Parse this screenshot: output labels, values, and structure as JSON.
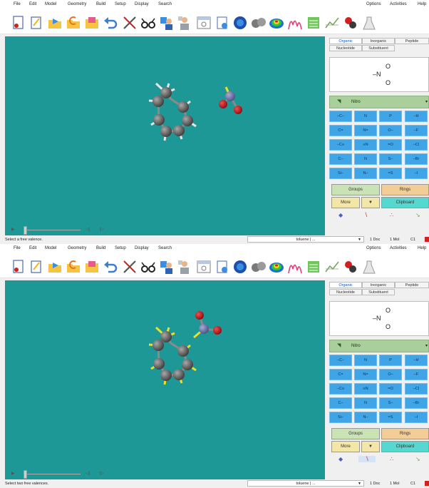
{
  "menu": [
    "File",
    "Edit",
    "Model",
    "Geometry",
    "Build",
    "Setup",
    "Display",
    "Search"
  ],
  "menu_right": [
    "Options",
    "Activities",
    "Help"
  ],
  "toolbar_icons": [
    "new-document",
    "edit-notes",
    "open-folder",
    "open-alt-folder",
    "save-folder",
    "undo",
    "tools-scissors",
    "view-glasses",
    "assistant-person",
    "assistant-person-2",
    "build-window",
    "document-view",
    "orbital-sphere",
    "molecules-gray",
    "surface-rainbow",
    "spectrum-curve",
    "green-chart",
    "plot-lines",
    "flask-settings",
    "lab-flask"
  ],
  "tabs_row1": [
    "Organic",
    "Inorganic",
    "Peptide"
  ],
  "tabs_row2": [
    "Nucleotide",
    "Substituent"
  ],
  "preview_formula": [
    "–N",
    "O",
    "O"
  ],
  "nitro_label": "Nitro",
  "fragments": [
    [
      "–C–",
      "N",
      "P",
      "–H"
    ],
    [
      "C=",
      "N=",
      "O–",
      "–F"
    ],
    [
      "–C≡",
      "≡N",
      "=O",
      "–Cl"
    ],
    [
      "C–",
      "N",
      "S–",
      "–Br"
    ],
    [
      "Si–",
      "N–",
      "=S",
      "–I"
    ]
  ],
  "groups_label": "Groups",
  "rings_label": "Rings",
  "more_label": "More",
  "clipboard_label": "Clipboard",
  "playback": {
    "prev": "◁|",
    "next": "|▷"
  },
  "panels": [
    {
      "status": "Select a free valence."
    },
    {
      "status": "Select two free valences."
    }
  ],
  "combo_value": "toluene | ...",
  "doc_count": "1 Doc",
  "mol_count": "1 Mol",
  "point_group": "C1",
  "colors": {
    "viewport": "#1e9896",
    "carbon": "#5a5a5a",
    "hydrogen": "#e6e6e6",
    "highlight": "#e8e02a",
    "nitrogen": "#7276a8",
    "oxygen": "#c8141e",
    "fragment_button": "#3fa5e6"
  }
}
